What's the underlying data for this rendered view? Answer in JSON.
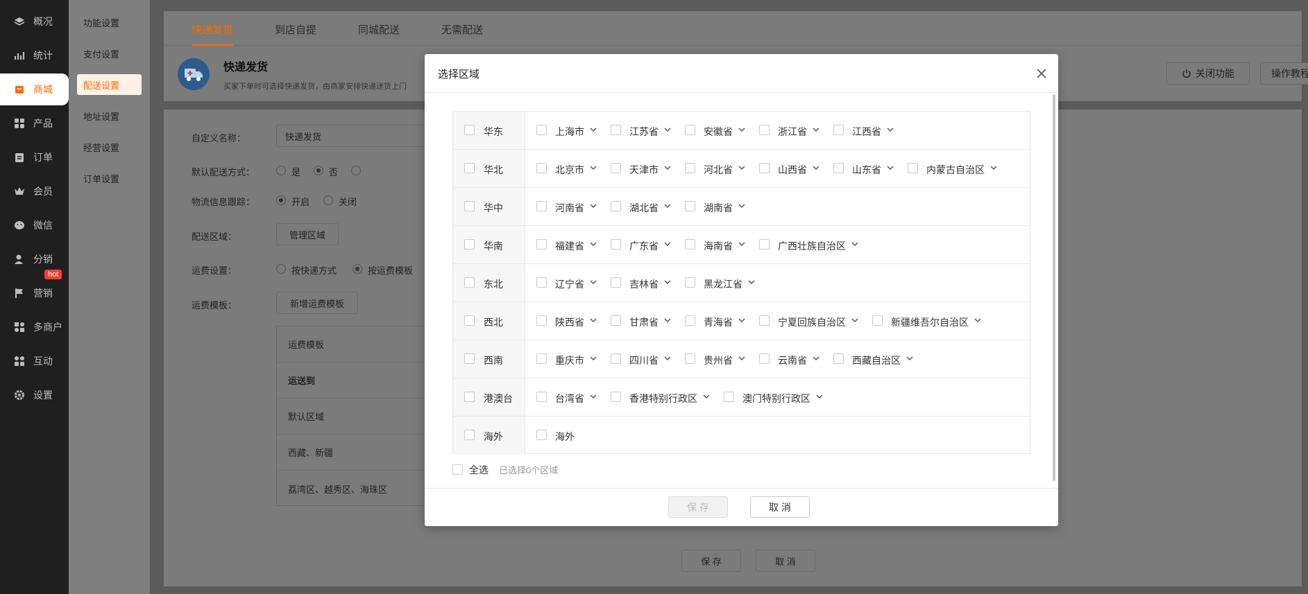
{
  "nav": {
    "items": [
      {
        "label": "概况",
        "icon": "layers-icon"
      },
      {
        "label": "统计",
        "icon": "chart-icon"
      },
      {
        "label": "商城",
        "icon": "shop-icon"
      },
      {
        "label": "产品",
        "icon": "grid-icon"
      },
      {
        "label": "订单",
        "icon": "order-icon"
      },
      {
        "label": "会员",
        "icon": "crown-icon"
      },
      {
        "label": "微信",
        "icon": "wechat-icon"
      },
      {
        "label": "分销",
        "icon": "user-icon"
      },
      {
        "label": "营销",
        "icon": "flag-icon"
      },
      {
        "label": "多商户",
        "icon": "merchant-icon"
      },
      {
        "label": "互动",
        "icon": "interact-icon"
      },
      {
        "label": "设置",
        "icon": "gear-icon"
      }
    ],
    "hot_badge": "hot"
  },
  "submenu": {
    "items": [
      "功能设置",
      "支付设置",
      "配送设置",
      "地址设置",
      "经营设置",
      "订单设置"
    ]
  },
  "page": {
    "tabs": [
      "快递发货",
      "到店自提",
      "同城配送",
      "无需配送"
    ],
    "title": "快递发货",
    "desc": "买家下单时可选择快递发货，由商家安排快递送货上门",
    "btn_close_feature": "关闭功能",
    "btn_tutorial": "操作教程",
    "form": {
      "name_label": "自定义名称：",
      "name_value": "快递发货",
      "default_label": "默认配送方式：",
      "default_yes": "是",
      "default_no": "否",
      "tracking_label": "物流信息跟踪：",
      "tracking_on": "开启",
      "tracking_off": "关闭",
      "area_label": "配送区域：",
      "area_button": "管理区域",
      "fee_label": "运费设置：",
      "fee_by_express": "按快递方式",
      "fee_by_template": "按运费模板",
      "template_label": "运费模板：",
      "template_button": "新增运费模板",
      "template_rows": [
        "运费模板",
        "运送到",
        "默认区域",
        "西藏、新疆",
        "荔湾区、越秀区、海珠区"
      ]
    },
    "bottom_save": "保 存",
    "bottom_cancel": "取 消"
  },
  "modal": {
    "title": "选择区域",
    "regions": [
      {
        "name": "华东",
        "provinces": [
          "上海市",
          "江苏省",
          "安徽省",
          "浙江省",
          "江西省"
        ]
      },
      {
        "name": "华北",
        "provinces": [
          "北京市",
          "天津市",
          "河北省",
          "山西省",
          "山东省",
          "内蒙古自治区"
        ]
      },
      {
        "name": "华中",
        "provinces": [
          "河南省",
          "湖北省",
          "湖南省"
        ]
      },
      {
        "name": "华南",
        "provinces": [
          "福建省",
          "广东省",
          "海南省",
          "广西壮族自治区"
        ]
      },
      {
        "name": "东北",
        "provinces": [
          "辽宁省",
          "吉林省",
          "黑龙江省"
        ]
      },
      {
        "name": "西北",
        "provinces": [
          "陕西省",
          "甘肃省",
          "青海省",
          "宁夏回族自治区",
          "新疆维吾尔自治区"
        ]
      },
      {
        "name": "西南",
        "provinces": [
          "重庆市",
          "四川省",
          "贵州省",
          "云南省",
          "西藏自治区"
        ]
      },
      {
        "name": "港澳台",
        "provinces": [
          "台湾省",
          "香港特别行政区",
          "澳门特别行政区"
        ]
      },
      {
        "name": "海外",
        "provinces": [
          "海外"
        ],
        "no_expand": true
      }
    ],
    "select_all": "全选",
    "selected_count": "已选择0个区域",
    "save": "保 存",
    "cancel": "取 消"
  },
  "colors": {
    "accent": "#ff6a00",
    "sidebar": "#1f1f1f"
  }
}
